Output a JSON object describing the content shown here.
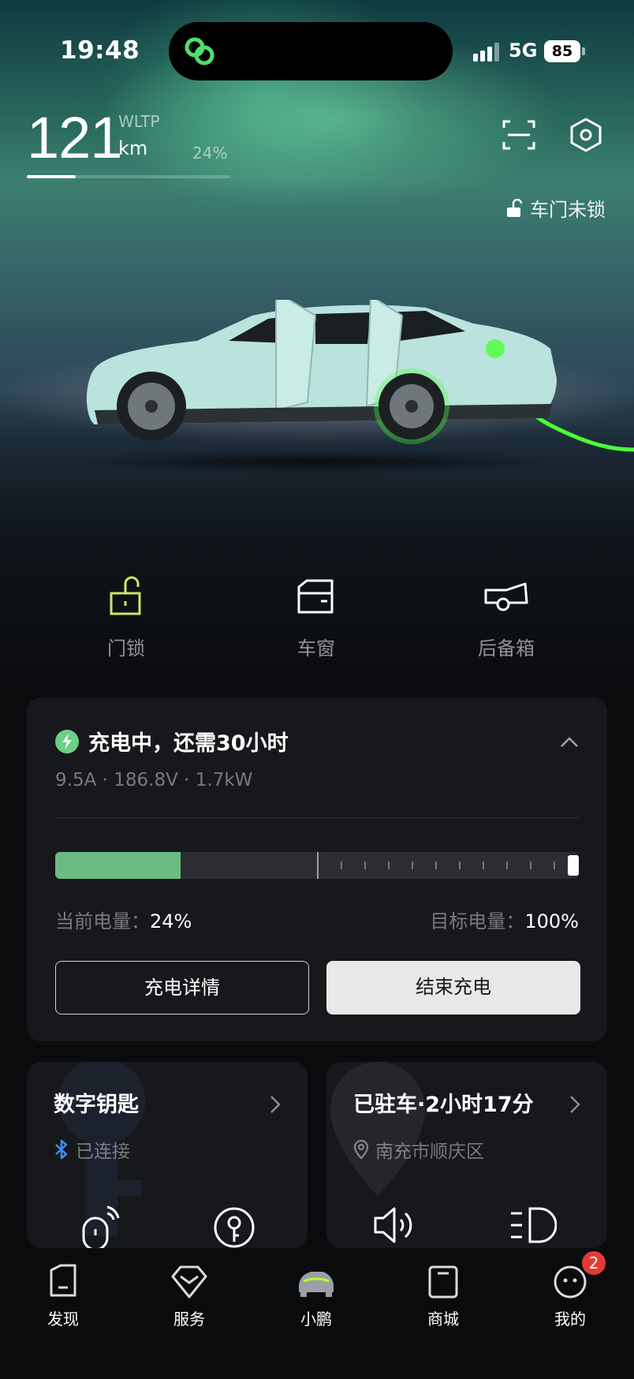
{
  "status_bar": {
    "time": "19:48",
    "network": "5G",
    "battery": "85"
  },
  "range": {
    "value": "121",
    "standard": "WLTP",
    "unit": "km",
    "battery_percent_label": "24%",
    "battery_fraction": 0.24
  },
  "header": {
    "lock_status": "车门未锁",
    "scan_icon": "scan-icon",
    "settings_icon": "settings-hexagon-icon"
  },
  "colors": {
    "accent_green": "#6cbb82",
    "charge_cable_green": "#4cff3a",
    "card_bg": "#16181c",
    "badge_red": "#e53935",
    "car_body": "#b9e3dc"
  },
  "quick_actions": [
    {
      "label": "门锁",
      "icon": "unlock-icon"
    },
    {
      "label": "车窗",
      "icon": "car-window-icon"
    },
    {
      "label": "后备箱",
      "icon": "trunk-icon"
    }
  ],
  "charging": {
    "title": "充电中，还需30小时",
    "stats": "9.5A · 186.8V · 1.7kW",
    "current_label": "当前电量：",
    "current_value": "24%",
    "current_fraction": 0.24,
    "target_label": "目标电量：",
    "target_value": "100%",
    "target_fraction": 1.0,
    "details_button": "充电详情",
    "stop_button": "结束充电"
  },
  "digital_key": {
    "title": "数字钥匙",
    "status": "已连接"
  },
  "parking": {
    "title": "已驻车·2小时17分",
    "location": "南充市顺庆区"
  },
  "tabs": [
    {
      "label": "发现",
      "icon": "discover-icon",
      "active": false
    },
    {
      "label": "服务",
      "icon": "service-icon",
      "active": false
    },
    {
      "label": "小鹏",
      "icon": "car-tab-icon",
      "active": true
    },
    {
      "label": "商城",
      "icon": "shop-icon",
      "active": false
    },
    {
      "label": "我的",
      "icon": "profile-icon",
      "active": false
    }
  ],
  "profile_badge": "2"
}
